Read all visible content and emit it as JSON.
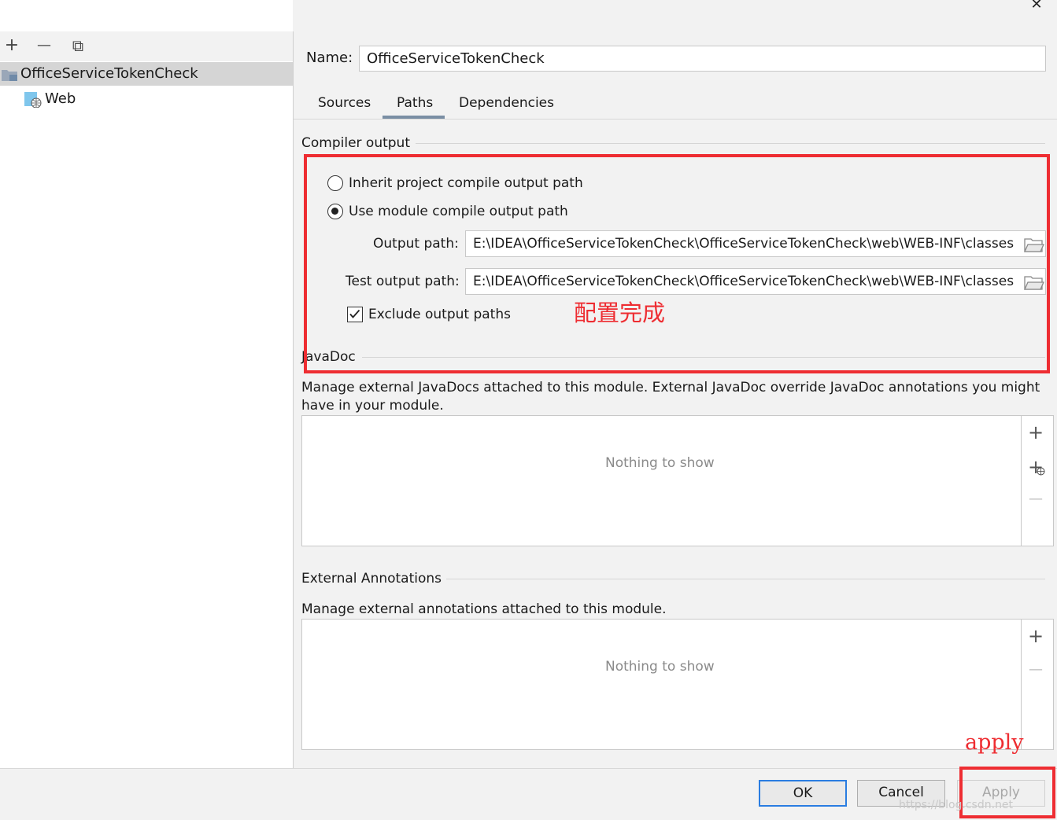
{
  "window": {
    "close_glyph": "✕"
  },
  "left_toolbar": {
    "add_glyph": "+",
    "remove_glyph": "—",
    "copy_glyph": "⧉"
  },
  "tree": {
    "module": "OfficeServiceTokenCheck",
    "facet": "Web"
  },
  "name_field": {
    "label": "Name:",
    "value": "OfficeServiceTokenCheck"
  },
  "tabs": [
    {
      "label": "Sources"
    },
    {
      "label": "Paths",
      "active": true
    },
    {
      "label": "Dependencies"
    }
  ],
  "compiler_output": {
    "title": "Compiler output",
    "option_inherit": "Inherit project compile output path",
    "option_module": "Use module compile output path",
    "selected": "option_module",
    "output_path_label": "Output path:",
    "output_path_value": "E:\\IDEA\\OfficeServiceTokenCheck\\OfficeServiceTokenCheck\\web\\WEB-INF\\classes",
    "test_output_path_label": "Test output path:",
    "test_output_path_value": "E:\\IDEA\\OfficeServiceTokenCheck\\OfficeServiceTokenCheck\\web\\WEB-INF\\classes",
    "exclude_label": "Exclude output paths",
    "exclude_checked": true
  },
  "javadoc": {
    "title": "JavaDoc",
    "description": "Manage external JavaDocs attached to this module. External JavaDoc override JavaDoc annotations you might have in your module.",
    "empty_text": "Nothing to show",
    "add_glyph": "+",
    "add_url_glyph": "+",
    "remove_glyph": "—"
  },
  "external_annotations": {
    "title": "External Annotations",
    "description": "Manage external annotations attached to this module.",
    "empty_text": "Nothing to show",
    "add_glyph": "+",
    "remove_glyph": "—"
  },
  "buttons": {
    "ok": "OK",
    "cancel": "Cancel",
    "apply": "Apply"
  },
  "annotations": {
    "config_done": "配置完成",
    "apply_note": "apply",
    "color": "#ee2d32"
  },
  "watermark": "https://blog.csdn.net"
}
